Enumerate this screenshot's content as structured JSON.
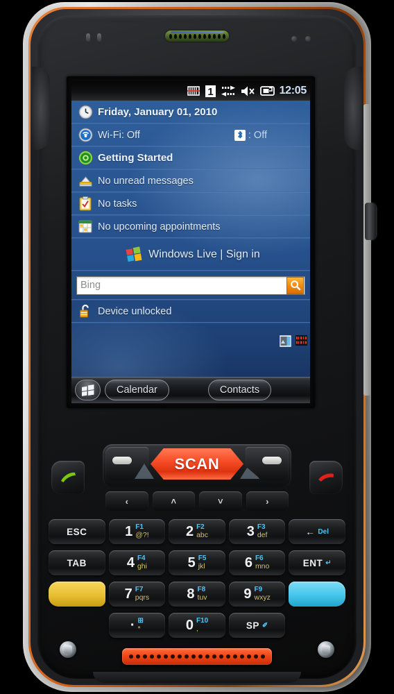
{
  "device": {
    "name": "rugged-handheld-terminal",
    "colors": {
      "bumper": "#c9c9c7",
      "accent_orange": "#c75a16",
      "body": "#1d1f22",
      "scan_red": "#f8502a",
      "speaker_red": "#f24716"
    }
  },
  "statusbar": {
    "icons": [
      "signal-off-icon",
      "profile-one-icon",
      "connectivity-icon",
      "volume-icon",
      "battery-plug-icon"
    ],
    "time": "12:05"
  },
  "home": {
    "rows": [
      {
        "icon": "clock-icon",
        "text": "Friday, January 01, 2010",
        "bold": true
      },
      {
        "icon": "wifi-icon",
        "text": "Wi-Fi: Off",
        "bold": false,
        "right_icon": "bluetooth-icon",
        "right_text": ": Off"
      },
      {
        "icon": "getting-started-icon",
        "text": "Getting Started",
        "bold": true
      },
      {
        "icon": "messages-icon",
        "text": "No unread messages",
        "bold": false
      },
      {
        "icon": "tasks-icon",
        "text": "No tasks",
        "bold": false
      },
      {
        "icon": "calendar-icon",
        "text": "No upcoming appointments",
        "bold": false
      }
    ],
    "live": {
      "icon": "windows-live-icon",
      "label": "Windows Live  |  Sign in"
    },
    "search": {
      "placeholder": "Bing",
      "value": "",
      "button_icon": "search-icon"
    },
    "lock": {
      "icon": "unlocked-padlock-icon",
      "text": "Device unlocked"
    },
    "tray": [
      "scanner-tray-icon",
      "barcode-tray-icon"
    ]
  },
  "taskbar": {
    "start_icon": "windows-start-icon",
    "left_button": "Calendar",
    "right_button": "Contacts"
  },
  "keypad": {
    "scan_label": "SCAN",
    "call_green_icon": "call-answer-icon",
    "call_red_icon": "call-end-icon",
    "nav": [
      {
        "name": "nav-left",
        "glyph": "‹"
      },
      {
        "name": "nav-up",
        "glyph": "˄"
      },
      {
        "name": "nav-down",
        "glyph": "˅"
      },
      {
        "name": "nav-right",
        "glyph": "›"
      }
    ],
    "rows": [
      [
        {
          "name": "key-esc",
          "label": "ESC"
        },
        {
          "name": "key-1",
          "big": "1",
          "fn": "F1",
          "alt": "@?!"
        },
        {
          "name": "key-2",
          "big": "2",
          "fn": "F2",
          "alt": "abc"
        },
        {
          "name": "key-3",
          "big": "3",
          "fn": "F3",
          "alt": "def"
        },
        {
          "name": "key-del",
          "label": "←",
          "fn": "Del"
        }
      ],
      [
        {
          "name": "key-tab",
          "label": "TAB"
        },
        {
          "name": "key-4",
          "big": "4",
          "fn": "F4",
          "alt": "ghi"
        },
        {
          "name": "key-5",
          "big": "5",
          "fn": "F5",
          "alt": "jkl"
        },
        {
          "name": "key-6",
          "big": "6",
          "fn": "F6",
          "alt": "mno"
        },
        {
          "name": "key-enter",
          "label": "ENT",
          "fn": "↵"
        }
      ],
      [
        {
          "name": "key-yellow-func",
          "label": "",
          "style": "yellow"
        },
        {
          "name": "key-7",
          "big": "7",
          "fn": "F7",
          "alt": "pqrs"
        },
        {
          "name": "key-8",
          "big": "8",
          "fn": "F8",
          "alt": "tuv"
        },
        {
          "name": "key-9",
          "big": "9",
          "fn": "F9",
          "alt": "wxyz"
        },
        {
          "name": "key-cyan-func",
          "label": "",
          "style": "cyan"
        }
      ],
      [
        {
          "name": "key-spacer-left",
          "label": "",
          "style": "blank"
        },
        {
          "name": "key-dot-star",
          "big": "·",
          "fn": "⊞",
          "alt": "*"
        },
        {
          "name": "key-0",
          "big": "0",
          "fn": "F10",
          "alt": ","
        },
        {
          "name": "key-sp",
          "label": "SP",
          "fn": "✐"
        },
        {
          "name": "key-spacer-right",
          "label": "",
          "style": "blank"
        }
      ]
    ]
  }
}
